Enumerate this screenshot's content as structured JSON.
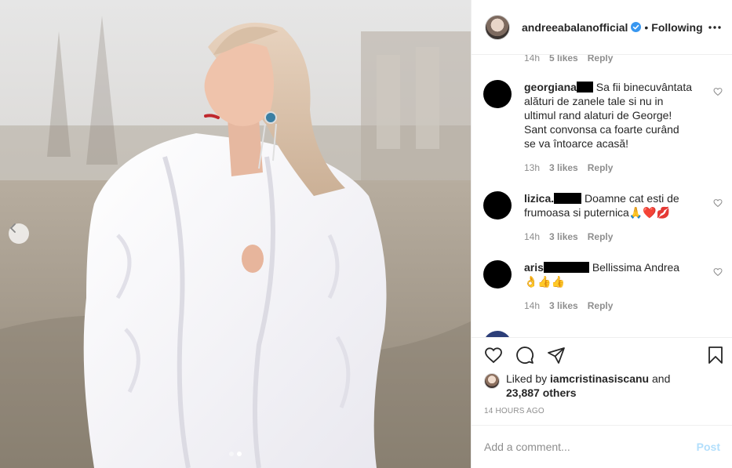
{
  "post": {
    "username": "andreeabalanofficial",
    "separator": "•",
    "follow_state": "Following",
    "likes_prefix": "Liked by",
    "liked_by": "iamcristinasiscanu",
    "liked_conj": "and",
    "likes_others": "23,887 others",
    "time_ago": "14 HOURS AGO"
  },
  "first_meta": {
    "time": "14h",
    "likes": "5 likes",
    "reply": "Reply"
  },
  "comments": [
    {
      "user": "georgiana",
      "text": "Sa fii binecuvântata alături de zanele tale si nu in ultimul rand alaturi de George! Sant convonsa ca foarte curând se va întoarce acasă!",
      "time": "13h",
      "likes": "3 likes",
      "reply": "Reply"
    },
    {
      "user": "lizica.",
      "text": "Doamne cat esti de frumoasa si puternica🙏❤️💋",
      "time": "14h",
      "likes": "3 likes",
      "reply": "Reply"
    },
    {
      "user": "aris",
      "text": "Bellissima Andrea 👌👍👍",
      "time": "14h",
      "likes": "3 likes",
      "reply": "Reply"
    }
  ],
  "add_comment": {
    "placeholder": "Add a comment...",
    "post_label": "Post"
  },
  "icons": {
    "verified": "verified-badge-icon",
    "more": "more-options-icon",
    "like": "heart-icon",
    "comment": "comment-icon",
    "share": "share-icon",
    "save": "bookmark-icon",
    "prev": "chevron-left-icon"
  },
  "colors": {
    "verified": "#3897f0",
    "post_disabled": "#b2dffc",
    "meta_gray": "#8e8e8e"
  }
}
